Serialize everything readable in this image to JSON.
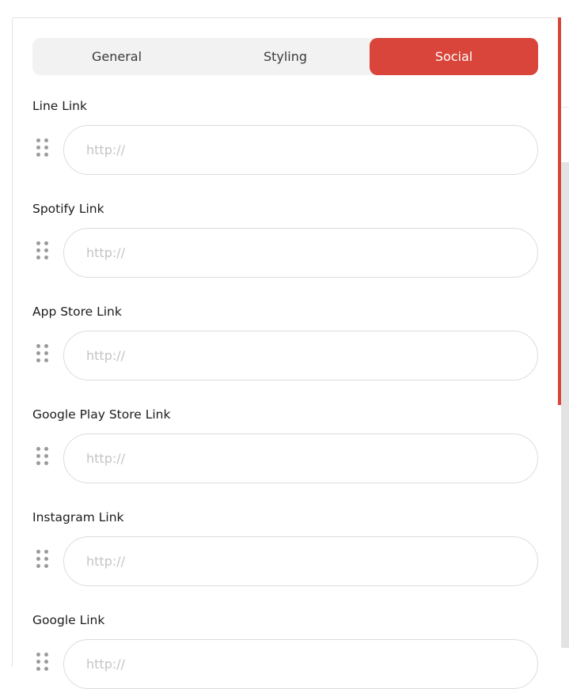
{
  "tabs": [
    {
      "label": "General",
      "active": false
    },
    {
      "label": "Styling",
      "active": false
    },
    {
      "label": "Social",
      "active": true
    }
  ],
  "colors": {
    "accent": "#d9453a",
    "tab_bg": "#f2f2f2",
    "input_border": "#dcdcdc"
  },
  "fields": [
    {
      "label": "Line Link",
      "placeholder": "http://",
      "value": ""
    },
    {
      "label": "Spotify Link",
      "placeholder": "http://",
      "value": ""
    },
    {
      "label": "App Store Link",
      "placeholder": "http://",
      "value": ""
    },
    {
      "label": "Google Play Store Link",
      "placeholder": "http://",
      "value": ""
    },
    {
      "label": "Instagram Link",
      "placeholder": "http://",
      "value": ""
    },
    {
      "label": "Google Link",
      "placeholder": "http://",
      "value": ""
    }
  ]
}
